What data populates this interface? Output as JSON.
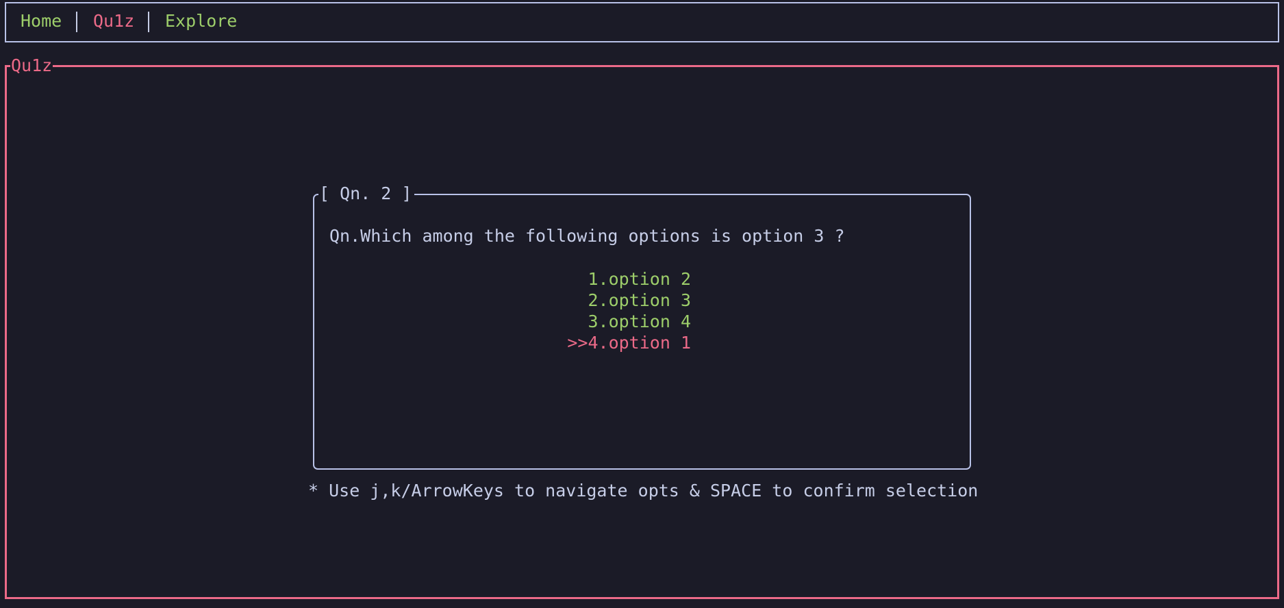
{
  "colors": {
    "background": "#1b1b27",
    "text": "#c6cde7",
    "border": "#b9c2e8",
    "accent_green": "#9dce6a",
    "accent_red": "#ec6a88"
  },
  "nav": {
    "items": [
      {
        "label": "Home",
        "active": false,
        "color": "#9dce6a"
      },
      {
        "label": "Qu1z",
        "active": true,
        "color": "#ec6a88"
      },
      {
        "label": "Explore",
        "active": false,
        "color": "#9dce6a"
      }
    ]
  },
  "main_panel": {
    "title": "Qu1z"
  },
  "question": {
    "box_title": "[ Qn. 2 ]",
    "text": "Qn.Which among the following options is option 3 ?",
    "options": [
      {
        "label": "1.option 2",
        "selected": false
      },
      {
        "label": "2.option 3",
        "selected": false
      },
      {
        "label": "3.option 4",
        "selected": false
      },
      {
        "label": ">>4.option 1",
        "selected": true
      }
    ]
  },
  "hint": "* Use j,k/ArrowKeys to navigate opts & SPACE to confirm selection"
}
